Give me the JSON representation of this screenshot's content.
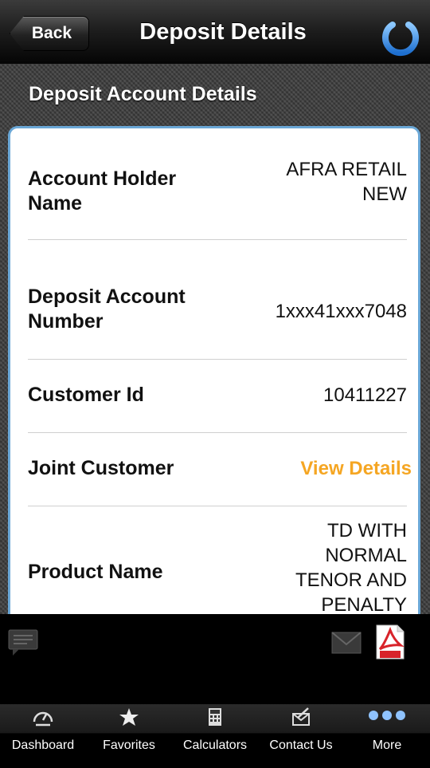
{
  "nav": {
    "back_label": "Back",
    "title": "Deposit Details"
  },
  "section": {
    "title": "Deposit Account Details"
  },
  "details": [
    {
      "label": "Account Holder Name",
      "value": "AFRA RETAIL NEW"
    },
    {
      "label": "Deposit Account Number",
      "value": "1xxx41xxx7048"
    },
    {
      "label": "Customer Id",
      "value": "10411227"
    },
    {
      "label": "Joint Customer",
      "value": "View Details"
    },
    {
      "label": "Product Name",
      "value": "TD WITH NORMAL TENOR AND PENALTY"
    }
  ],
  "tabs": [
    {
      "label": "Dashboard",
      "icon": "dashboard-icon"
    },
    {
      "label": "Favorites",
      "icon": "star-icon"
    },
    {
      "label": "Calculators",
      "icon": "calculator-icon"
    },
    {
      "label": "Contact Us",
      "icon": "contact-icon"
    },
    {
      "label": "More",
      "icon": "more-dots-icon"
    }
  ],
  "colors": {
    "link": "#f5a623",
    "power": "#2f8be0",
    "card_border": "#6aa7d6"
  }
}
